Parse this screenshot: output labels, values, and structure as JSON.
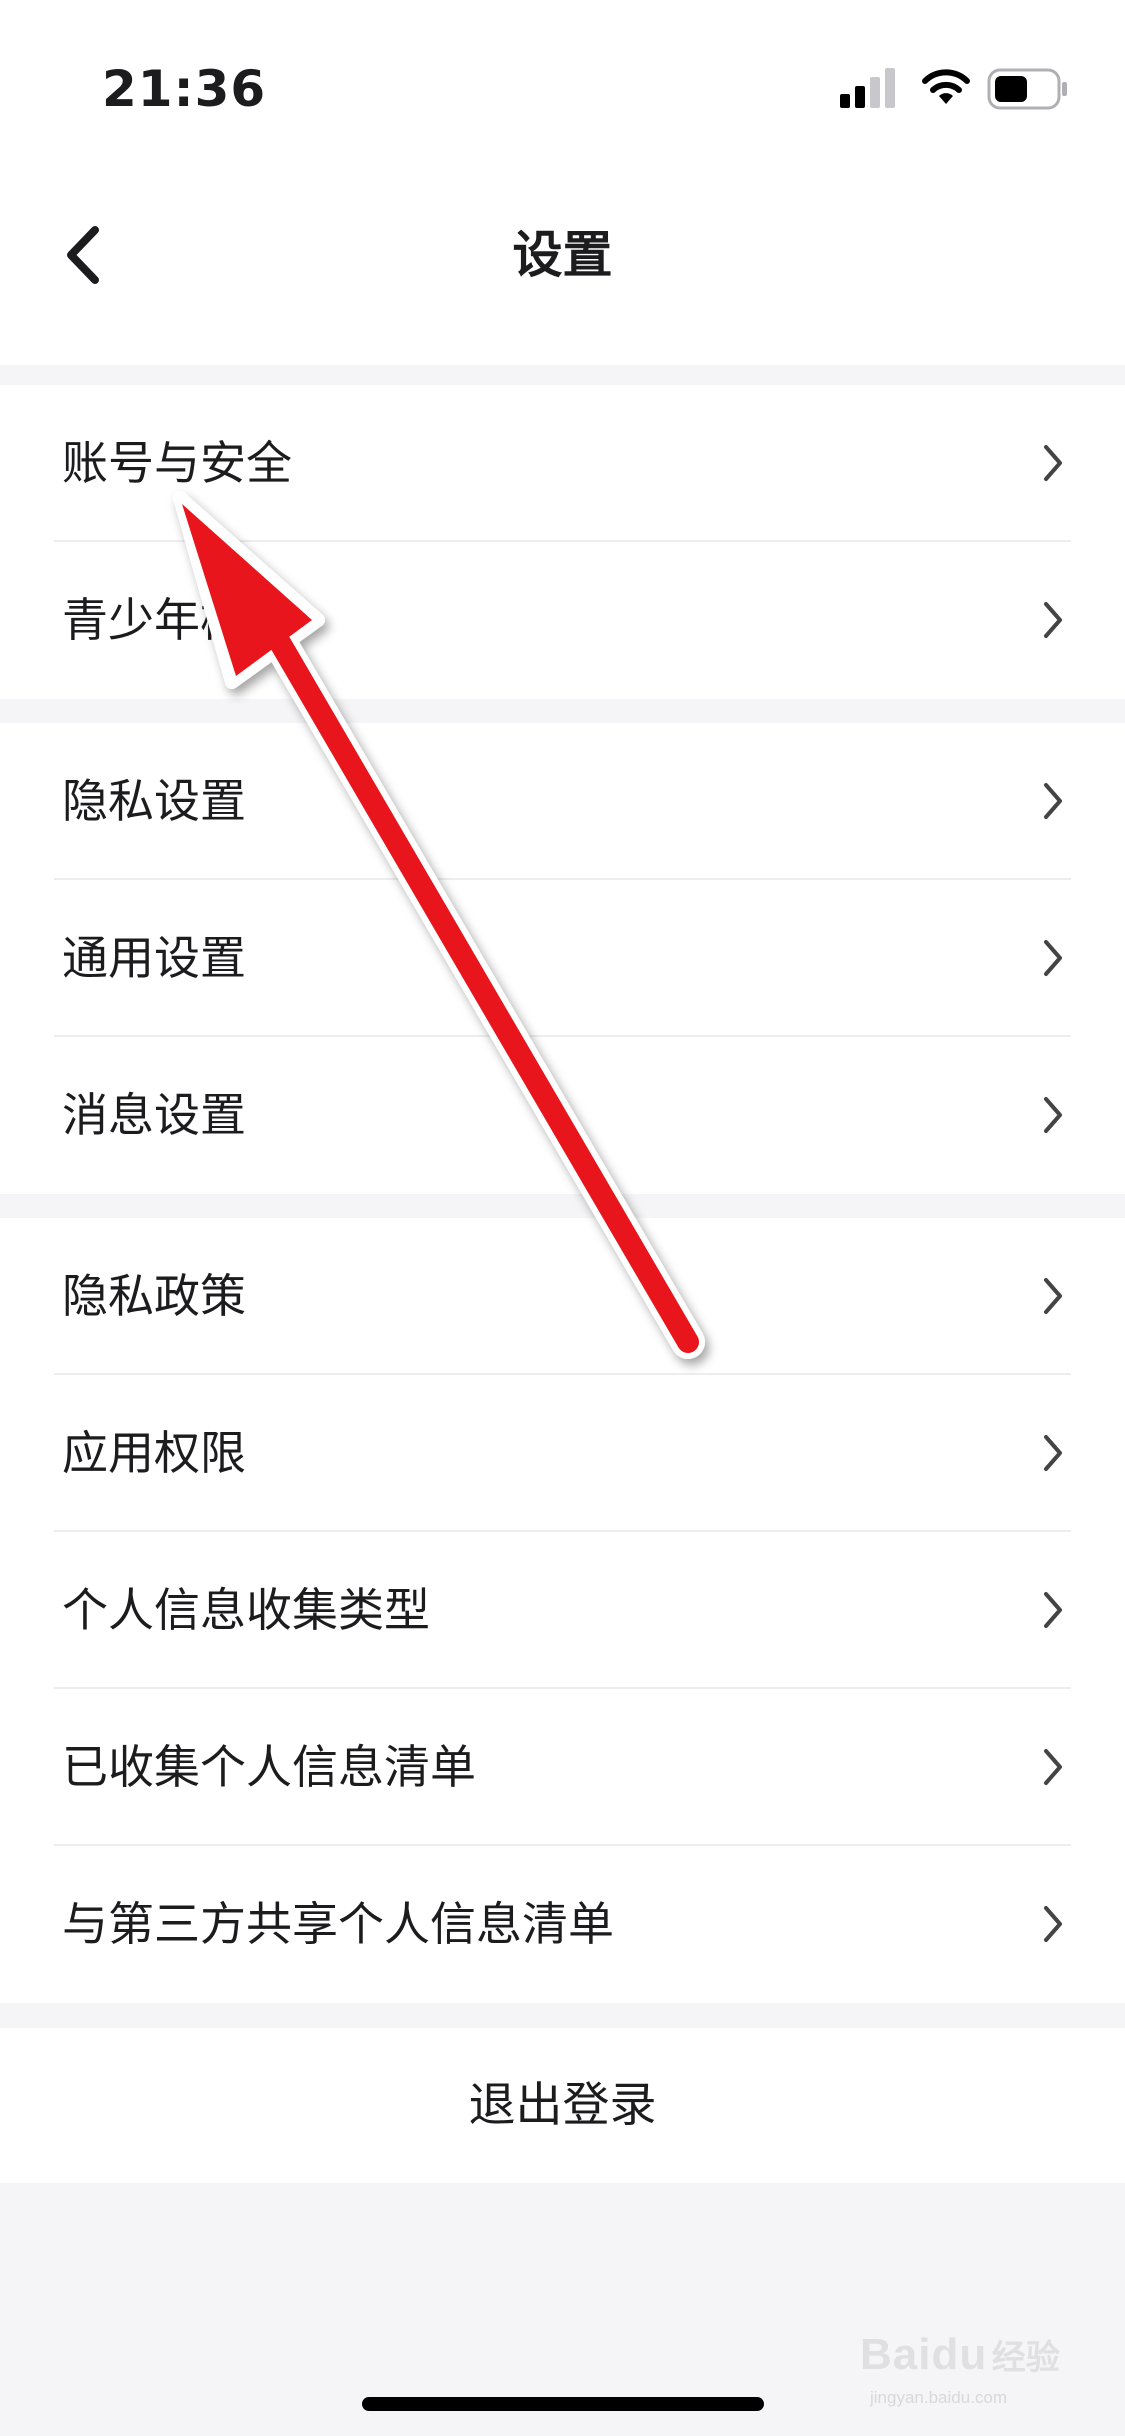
{
  "status_bar": {
    "time": "21:36",
    "signal_icon": "cellular-signal-icon",
    "wifi_icon": "wifi-icon",
    "battery_icon": "battery-icon"
  },
  "nav": {
    "back_icon": "chevron-left-icon",
    "title": "设置"
  },
  "sections": [
    {
      "items": [
        {
          "label": "账号与安全",
          "icon": "chevron-right-icon"
        },
        {
          "label": "青少年模式",
          "icon": "chevron-right-icon"
        }
      ]
    },
    {
      "items": [
        {
          "label": "隐私设置",
          "icon": "chevron-right-icon"
        },
        {
          "label": "通用设置",
          "icon": "chevron-right-icon"
        },
        {
          "label": "消息设置",
          "icon": "chevron-right-icon"
        }
      ]
    },
    {
      "items": [
        {
          "label": "隐私政策",
          "icon": "chevron-right-icon"
        },
        {
          "label": "应用权限",
          "icon": "chevron-right-icon"
        },
        {
          "label": "个人信息收集类型",
          "icon": "chevron-right-icon"
        },
        {
          "label": "已收集个人信息清单",
          "icon": "chevron-right-icon"
        },
        {
          "label": "与第三方共享个人信息清单",
          "icon": "chevron-right-icon"
        }
      ]
    }
  ],
  "logout_label": "退出登录",
  "watermark": {
    "brand": "Bai",
    "brand_tail": "du",
    "cn": "经验",
    "url": "jingyan.baidu.com"
  },
  "annotation": {
    "type": "red-arrow",
    "color": "#e8141b",
    "points_to": "账号与安全"
  }
}
